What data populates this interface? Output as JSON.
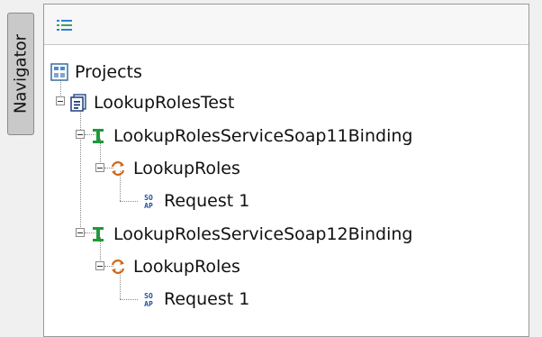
{
  "navigator": {
    "label": "Navigator",
    "icon": "navigator-tab"
  },
  "toolbar": {
    "tree_button_icon": "tree-view-icon"
  },
  "tree": {
    "root": {
      "label": "Projects",
      "icon": "projects-icon"
    },
    "project": {
      "label": "LookupRolesTest",
      "icon": "project-icon"
    },
    "bindings": [
      {
        "label": "LookupRolesServiceSoap11Binding",
        "icon": "binding-icon",
        "operation": {
          "label": "LookupRoles",
          "icon": "operation-icon"
        },
        "request": {
          "label": "Request 1",
          "icon": "soap-request-icon"
        }
      },
      {
        "label": "LookupRolesServiceSoap12Binding",
        "icon": "binding-icon",
        "operation": {
          "label": "LookupRoles",
          "icon": "operation-icon"
        },
        "request": {
          "label": "Request 1",
          "icon": "soap-request-icon"
        }
      }
    ]
  },
  "colors": {
    "binding_green": "#1f9a3a",
    "operation_orange": "#d0661b",
    "soap_blue": "#1a4fa0"
  }
}
